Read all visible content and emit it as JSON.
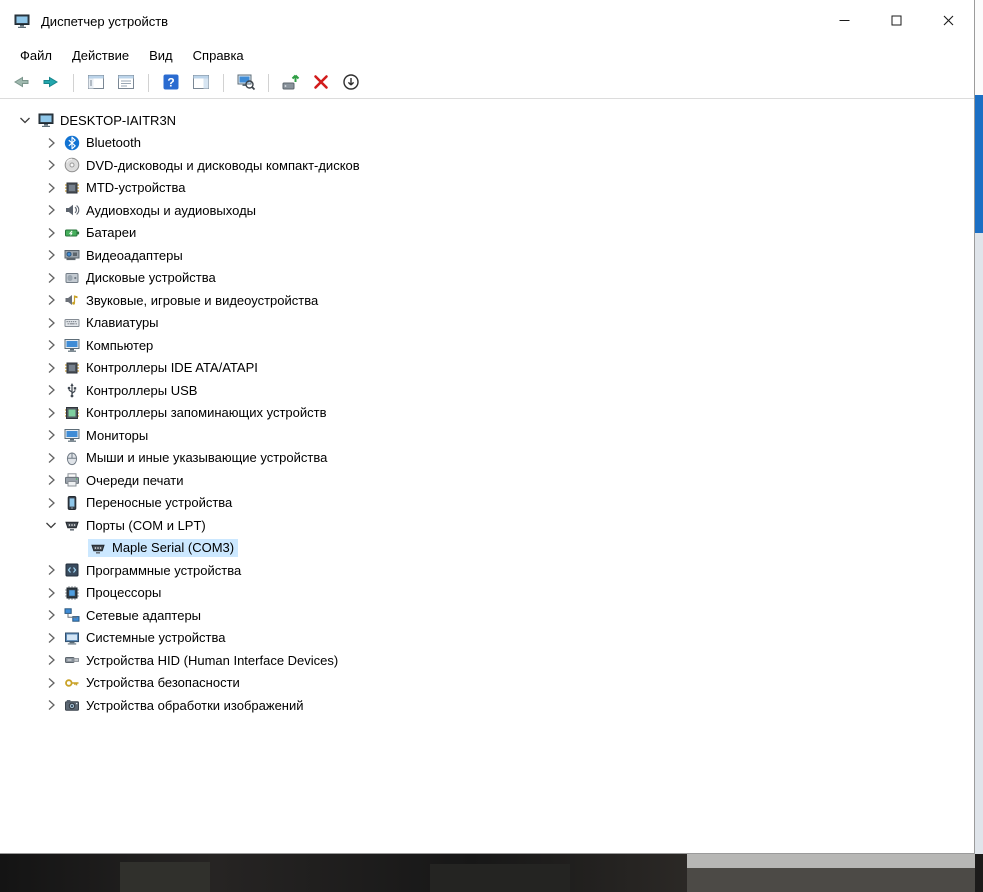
{
  "window": {
    "title": "Диспетчер устройств",
    "controls": [
      "minimize",
      "maximize",
      "close"
    ]
  },
  "menu": {
    "items": [
      {
        "id": "file",
        "label": "Файл"
      },
      {
        "id": "action",
        "label": "Действие"
      },
      {
        "id": "view",
        "label": "Вид"
      },
      {
        "id": "help",
        "label": "Справка"
      }
    ]
  },
  "toolbar": {
    "items": [
      {
        "type": "button",
        "name": "back"
      },
      {
        "type": "button",
        "name": "forward"
      },
      {
        "type": "separator"
      },
      {
        "type": "button",
        "name": "show-console-tree"
      },
      {
        "type": "button",
        "name": "properties"
      },
      {
        "type": "separator"
      },
      {
        "type": "button",
        "name": "help"
      },
      {
        "type": "button",
        "name": "action-pane"
      },
      {
        "type": "separator"
      },
      {
        "type": "button",
        "name": "scan-hardware"
      },
      {
        "type": "separator"
      },
      {
        "type": "button",
        "name": "update-driver"
      },
      {
        "type": "button",
        "name": "uninstall-device"
      },
      {
        "type": "button",
        "name": "disable-device"
      }
    ]
  },
  "tree": {
    "rows": [
      {
        "name": "desktop-iaitr3n",
        "label": "DESKTOP-IAITR3N",
        "icon": "computer-icon",
        "level": 0,
        "chevron": "expanded",
        "selected": false
      },
      {
        "name": "bluetooth",
        "label": "Bluetooth",
        "icon": "bluetooth-icon",
        "level": 1,
        "chevron": "collapsed",
        "selected": false
      },
      {
        "name": "dvd-drives",
        "label": "DVD-дисководы и дисководы компакт-дисков",
        "icon": "dvd-icon",
        "level": 1,
        "chevron": "collapsed",
        "selected": false
      },
      {
        "name": "mtd-devices",
        "label": "MTD-устройства",
        "icon": "chip-icon",
        "level": 1,
        "chevron": "collapsed",
        "selected": false
      },
      {
        "name": "audio-inputs-outputs",
        "label": "Аудиовходы и аудиовыходы",
        "icon": "audio-icon",
        "level": 1,
        "chevron": "collapsed",
        "selected": false
      },
      {
        "name": "batteries",
        "label": "Батареи",
        "icon": "battery-icon",
        "level": 1,
        "chevron": "collapsed",
        "selected": false
      },
      {
        "name": "video-adapters",
        "label": "Видеоадаптеры",
        "icon": "video-adapter-icon",
        "level": 1,
        "chevron": "collapsed",
        "selected": false
      },
      {
        "name": "disk-devices",
        "label": "Дисковые устройства",
        "icon": "disk-icon",
        "level": 1,
        "chevron": "collapsed",
        "selected": false
      },
      {
        "name": "sound-game-video",
        "label": "Звуковые, игровые и видеоустройства",
        "icon": "sound-icon",
        "level": 1,
        "chevron": "collapsed",
        "selected": false
      },
      {
        "name": "keyboards",
        "label": "Клавиатуры",
        "icon": "keyboard-icon",
        "level": 1,
        "chevron": "collapsed",
        "selected": false
      },
      {
        "name": "computer",
        "label": "Компьютер",
        "icon": "monitor-icon",
        "level": 1,
        "chevron": "collapsed",
        "selected": false
      },
      {
        "name": "ide-controllers",
        "label": "Контроллеры IDE ATA/ATAPI",
        "icon": "chip-icon",
        "level": 1,
        "chevron": "collapsed",
        "selected": false
      },
      {
        "name": "usb-controllers",
        "label": "Контроллеры USB",
        "icon": "usb-icon",
        "level": 1,
        "chevron": "collapsed",
        "selected": false
      },
      {
        "name": "storage-controllers",
        "label": "Контроллеры запоминающих устройств",
        "icon": "storage-icon",
        "level": 1,
        "chevron": "collapsed",
        "selected": false
      },
      {
        "name": "monitors",
        "label": "Мониторы",
        "icon": "monitor-icon",
        "level": 1,
        "chevron": "collapsed",
        "selected": false
      },
      {
        "name": "mice",
        "label": "Мыши и иные указывающие устройства",
        "icon": "mouse-icon",
        "level": 1,
        "chevron": "collapsed",
        "selected": false
      },
      {
        "name": "print-queues",
        "label": "Очереди печати",
        "icon": "printer-icon",
        "level": 1,
        "chevron": "collapsed",
        "selected": false
      },
      {
        "name": "portable-devices",
        "label": "Переносные устройства",
        "icon": "portable-icon",
        "level": 1,
        "chevron": "collapsed",
        "selected": false
      },
      {
        "name": "ports-com-lpt",
        "label": "Порты (COM и LPT)",
        "icon": "port-icon",
        "level": 1,
        "chevron": "expanded",
        "selected": false
      },
      {
        "name": "maple-serial-com3",
        "label": "Maple Serial (COM3)",
        "icon": "port-icon",
        "level": 2,
        "chevron": "none",
        "selected": true
      },
      {
        "name": "software-devices",
        "label": "Программные устройства",
        "icon": "software-icon",
        "level": 1,
        "chevron": "collapsed",
        "selected": false
      },
      {
        "name": "processors",
        "label": "Процессоры",
        "icon": "cpu-icon",
        "level": 1,
        "chevron": "collapsed",
        "selected": false
      },
      {
        "name": "network-adapters",
        "label": "Сетевые адаптеры",
        "icon": "network-icon",
        "level": 1,
        "chevron": "collapsed",
        "selected": false
      },
      {
        "name": "system-devices",
        "label": "Системные устройства",
        "icon": "system-icon",
        "level": 1,
        "chevron": "collapsed",
        "selected": false
      },
      {
        "name": "hid-devices",
        "label": "Устройства HID (Human Interface Devices)",
        "icon": "hid-icon",
        "level": 1,
        "chevron": "collapsed",
        "selected": false
      },
      {
        "name": "security-devices",
        "label": "Устройства безопасности",
        "icon": "security-icon",
        "level": 1,
        "chevron": "collapsed",
        "selected": false
      },
      {
        "name": "imaging-devices",
        "label": "Устройства обработки изображений",
        "icon": "imaging-icon",
        "level": 1,
        "chevron": "collapsed",
        "selected": false
      }
    ]
  },
  "colors": {
    "selection": "#cce8ff",
    "help_blue": "#2a6bd0",
    "uninstall_red": "#d21c1c",
    "forward_teal": "#22a6ad",
    "edge_blue": "#1b6fc4"
  }
}
